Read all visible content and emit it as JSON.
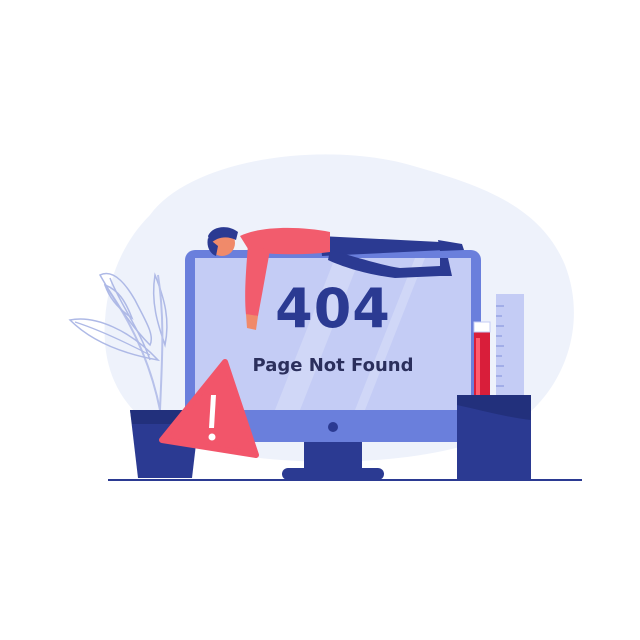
{
  "error_page": {
    "code": "404",
    "message": "Page Not Found"
  },
  "colors": {
    "screen": "#c4ccf5",
    "monitor_frame": "#6a7fdc",
    "navy": "#2b3a92",
    "person_shirt": "#f25c6d",
    "warning": "#f2556a",
    "blob": "#eef2fb"
  },
  "icons": [
    "warning-triangle-icon",
    "plant-illustration",
    "pen-holder-illustration",
    "sleeping-person-illustration"
  ]
}
